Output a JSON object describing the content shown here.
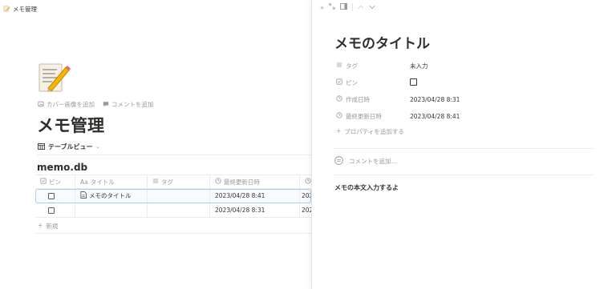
{
  "topbar": {
    "title": "メモ管理",
    "icon": "pencil-memo-icon"
  },
  "page": {
    "icon": "pencil-memo-icon",
    "add_cover": "カバー画像を追加",
    "add_comment": "コメントを追加",
    "title": "メモ管理",
    "view_label": "テーブルビュー"
  },
  "database": {
    "title": "memo.db",
    "columns": {
      "pin": "ピン",
      "title_prefix": "Aa",
      "title": "タイトル",
      "tag": "タグ",
      "updated": "最終更新日時"
    },
    "rows": [
      {
        "title": "メモのタイトル",
        "updated": "2023/04/28 8:41",
        "created": "202"
      },
      {
        "title": "",
        "updated": "2023/04/28 8:31",
        "created": "202"
      }
    ],
    "new_label": "新規"
  },
  "peek": {
    "title": "メモのタイトル",
    "properties": [
      {
        "name": "タグ",
        "value": "未入力"
      },
      {
        "name": "ピン",
        "value": ""
      },
      {
        "name": "作成日時",
        "value": "2023/04/28 8:31"
      },
      {
        "name": "最終更新日時",
        "value": "2023/04/28 8:41"
      }
    ],
    "add_property": "プロパティを追加する",
    "comment_placeholder": "コメントを追加...",
    "body": "メモの本文入力するよ"
  }
}
